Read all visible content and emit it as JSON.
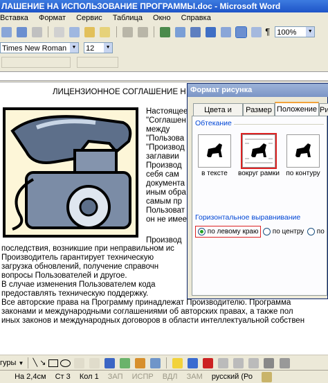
{
  "window": {
    "title": "ЛАШЕНИЕ НА ИСПОЛЬЗОВАНИЕ ПРОГРАММЫ.doc - Microsoft Word"
  },
  "menu": [
    "Вставка",
    "Формат",
    "Сервис",
    "Таблица",
    "Окно",
    "Справка"
  ],
  "standard_toolbar": {
    "zoom": "100%"
  },
  "format_toolbar": {
    "font": "Times New Roman",
    "size": "12"
  },
  "document": {
    "heading": "ЛИЦЕНЗИОННОЕ СОГЛАШЕНИЕ Н",
    "right_column": [
      "Настоящее",
      "\"Соглашен",
      "между",
      "\"Пользова",
      "\"Производ",
      "заглавии",
      "Производ",
      "себя сам",
      "документа",
      "иным обра",
      "самым пр",
      "Пользоват",
      "он не имеет"
    ],
    "right_column_after": "Производ",
    "lines": [
      "последствия, возникшие при неправильном ис",
      "Производитель гарантирует техническую",
      "загрузка обновлений, получение справочн",
      "вопросы Пользователей и другое.",
      "В случае изменения Пользователем кода",
      "предоставлять техническую поддержку.",
      "Все авторские права на Программу принадлежат Производителю. Программа",
      "законами и международными соглашениями об авторских правах, а также пол",
      "иных законов и международных договоров в области интеллектуальной собствен"
    ]
  },
  "dialog": {
    "title": "Формат рисунка",
    "tabs": [
      "Цвета и линии",
      "Размер",
      "Положение",
      "Ри"
    ],
    "active_tab": "Положение",
    "wrap_group": "Обтекание",
    "wrap_options": [
      "в тексте",
      "вокруг рамки",
      "по контуру"
    ],
    "wrap_selected": "вокруг рамки",
    "halign_group": "Горизонтальное выравнивание",
    "halign_options": [
      "по левому краю",
      "по центру",
      "по"
    ],
    "halign_selected": "по левому краю"
  },
  "drawing_toolbar": {
    "label": "гуры"
  },
  "status": {
    "position": "На 2,4см",
    "line": "Ст 3",
    "col": "Кол 1",
    "rec": "ЗАП",
    "trk": "ИСПР",
    "ext": "ВДЛ",
    "ovr": "ЗАМ",
    "language": "русский (Ро"
  },
  "colors": {
    "accent": "#1e54c8",
    "dialog_bg": "#ece9d8",
    "selection": "#d22222"
  }
}
